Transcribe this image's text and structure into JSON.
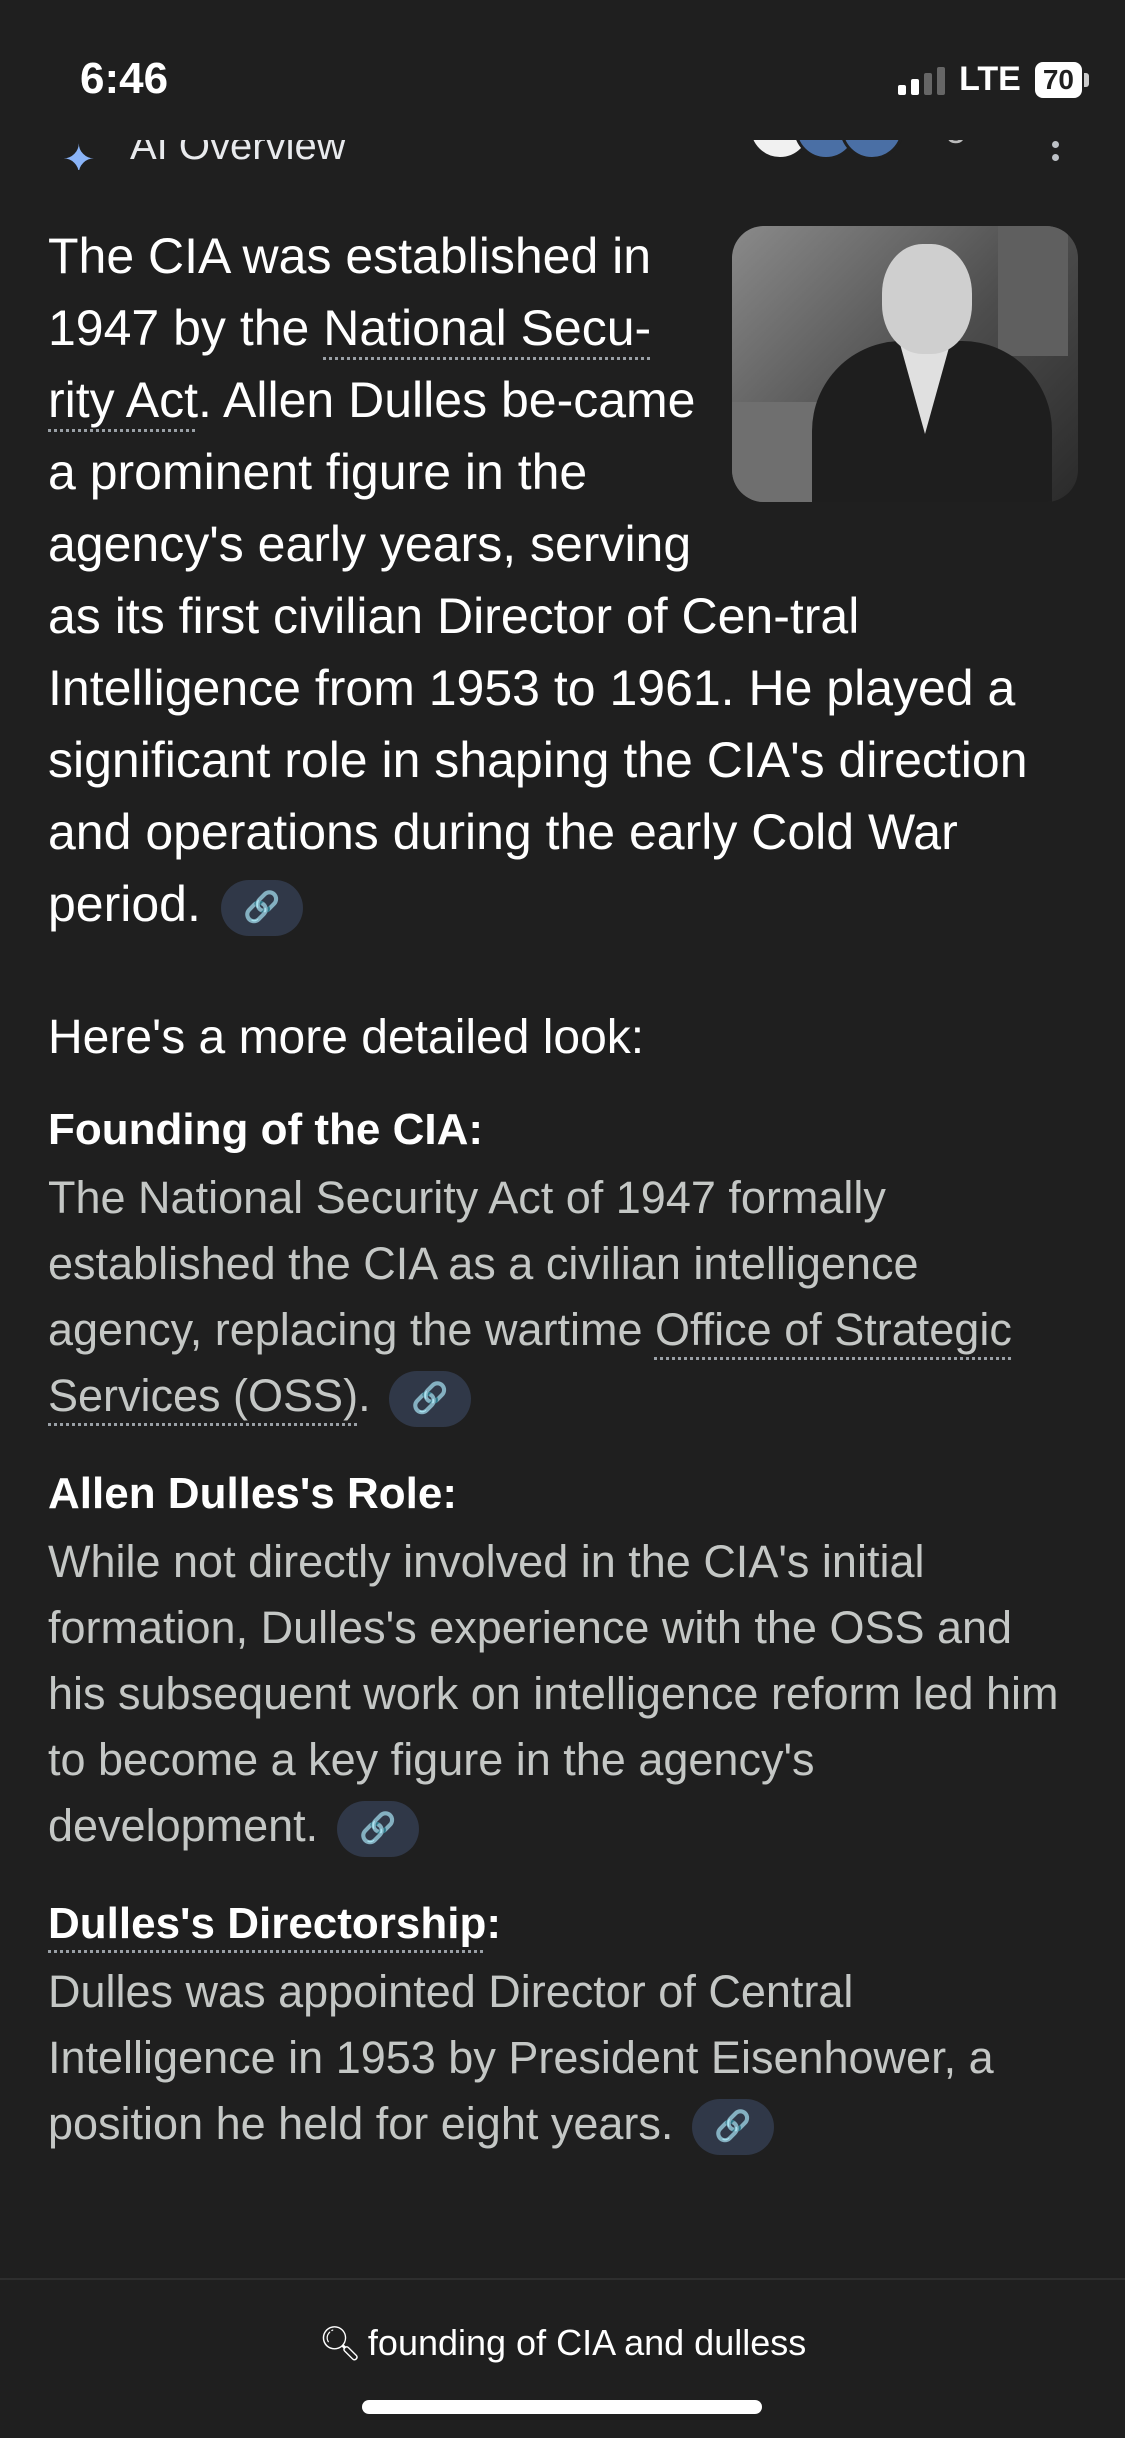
{
  "status": {
    "time": "6:46",
    "network": "LTE",
    "battery": "70"
  },
  "header": {
    "title": "AI Overview",
    "more_icon": "kebab-icon"
  },
  "lead": {
    "part1": "The CIA was established in 1947 by the ",
    "link": "National Secu-rity Act",
    "part2": ". Allen Dulles be-came a prominent figure in the agency's early years, serving as its first civilian Director of Cen-tral Intelligence from 1953 to 1961. He played a significant role in shaping the CIA's direction and operations during the early Cold War period."
  },
  "detail_heading": "Here's a more detailed look:",
  "sections": [
    {
      "title": "Founding of the CIA:",
      "text_before": "The National Security Act of 1947 formally established the CIA as a civilian intelligence agency, replacing the wartime ",
      "link": "Office of Strategic Services (OSS)",
      "text_after": "."
    },
    {
      "title": "Allen Dulles's Role:",
      "text": "While not directly involved in the CIA's initial formation, Dulles's experience with the OSS and his subsequent work on intelligence reform led him to become a key figure in the agency's development."
    },
    {
      "title_link": "Dulles's Directorship",
      "title_suffix": ":",
      "text": "Dulles was appointed Director of Central Intelligence in 1953 by President Eisenhower, a position he held for eight years."
    }
  ],
  "bottom": {
    "query": "founding of CIA and dulless"
  },
  "icons": {
    "chip": "link-icon",
    "search": "search-icon"
  },
  "colors": {
    "background": "#1f1f1f",
    "chip": "#303848",
    "accent": "#8ab4f8"
  }
}
